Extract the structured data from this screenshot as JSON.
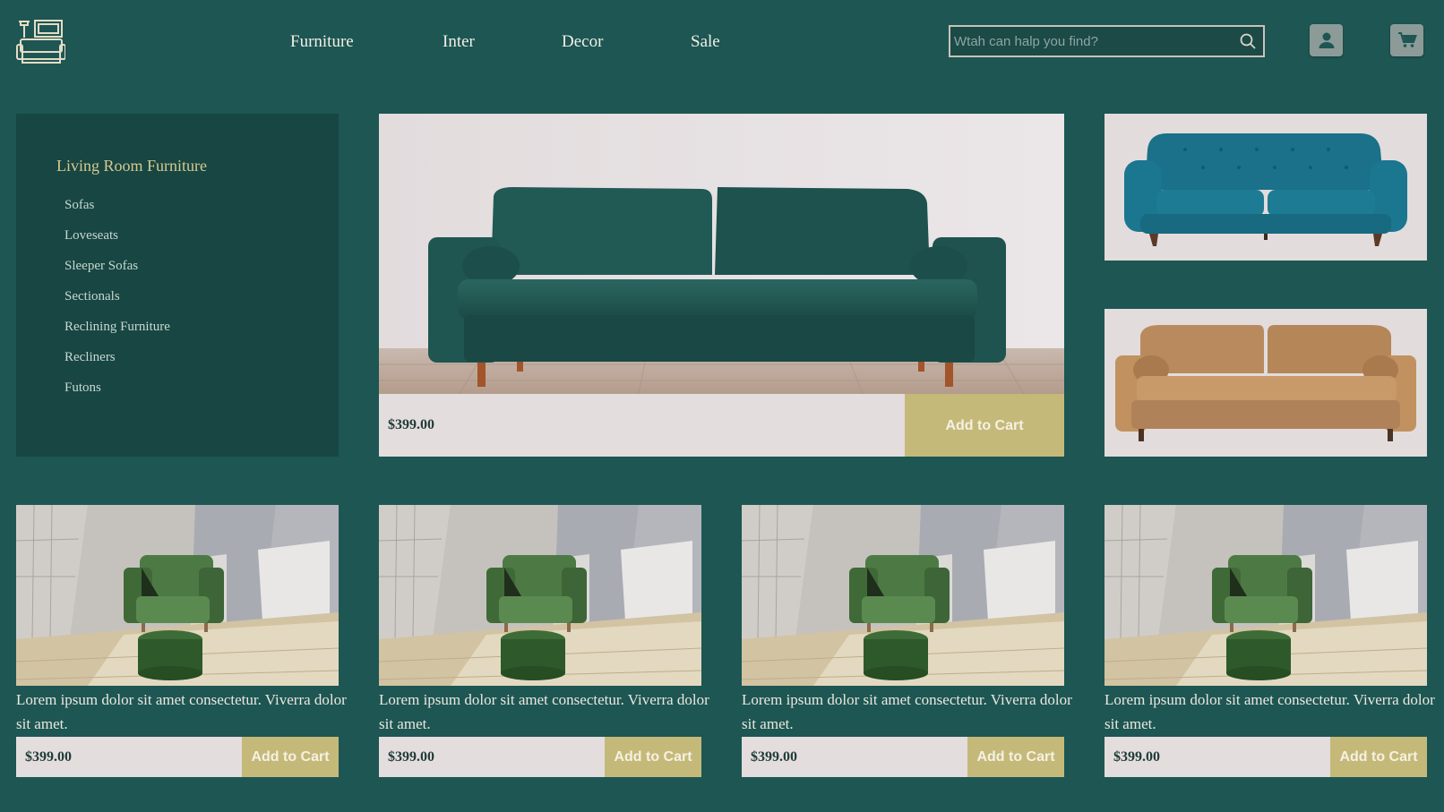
{
  "nav": {
    "links": [
      "Furniture",
      "Inter",
      "Decor",
      "Sale"
    ]
  },
  "search": {
    "placeholder": "Wtah can halp you find?"
  },
  "sidebar": {
    "title": "Living Room Furniture",
    "items": [
      "Sofas",
      "Loveseats",
      "Sleeper Sofas",
      "Sectionals",
      "Reclining Furniture",
      "Recliners",
      "Futons"
    ]
  },
  "featured": {
    "price": "$399.00",
    "cta": "Add to Cart"
  },
  "products": [
    {
      "desc": "Lorem ipsum dolor sit amet consectetur. Viverra dolor sit amet.",
      "price": "$399.00",
      "cta": "Add to Cart"
    },
    {
      "desc": "Lorem ipsum dolor sit amet consectetur. Viverra dolor sit amet.",
      "price": "$399.00",
      "cta": "Add to Cart"
    },
    {
      "desc": "Lorem ipsum dolor sit amet consectetur. Viverra dolor sit amet.",
      "price": "$399.00",
      "cta": "Add to Cart"
    },
    {
      "desc": "Lorem ipsum dolor sit amet consectetur. Viverra dolor sit amet.",
      "price": "$399.00",
      "cta": "Add to Cart"
    }
  ],
  "colors": {
    "background": "#1d5653",
    "sidebar": "#174643",
    "accent": "#c5b97a",
    "price_bar": "#e3dddd"
  }
}
